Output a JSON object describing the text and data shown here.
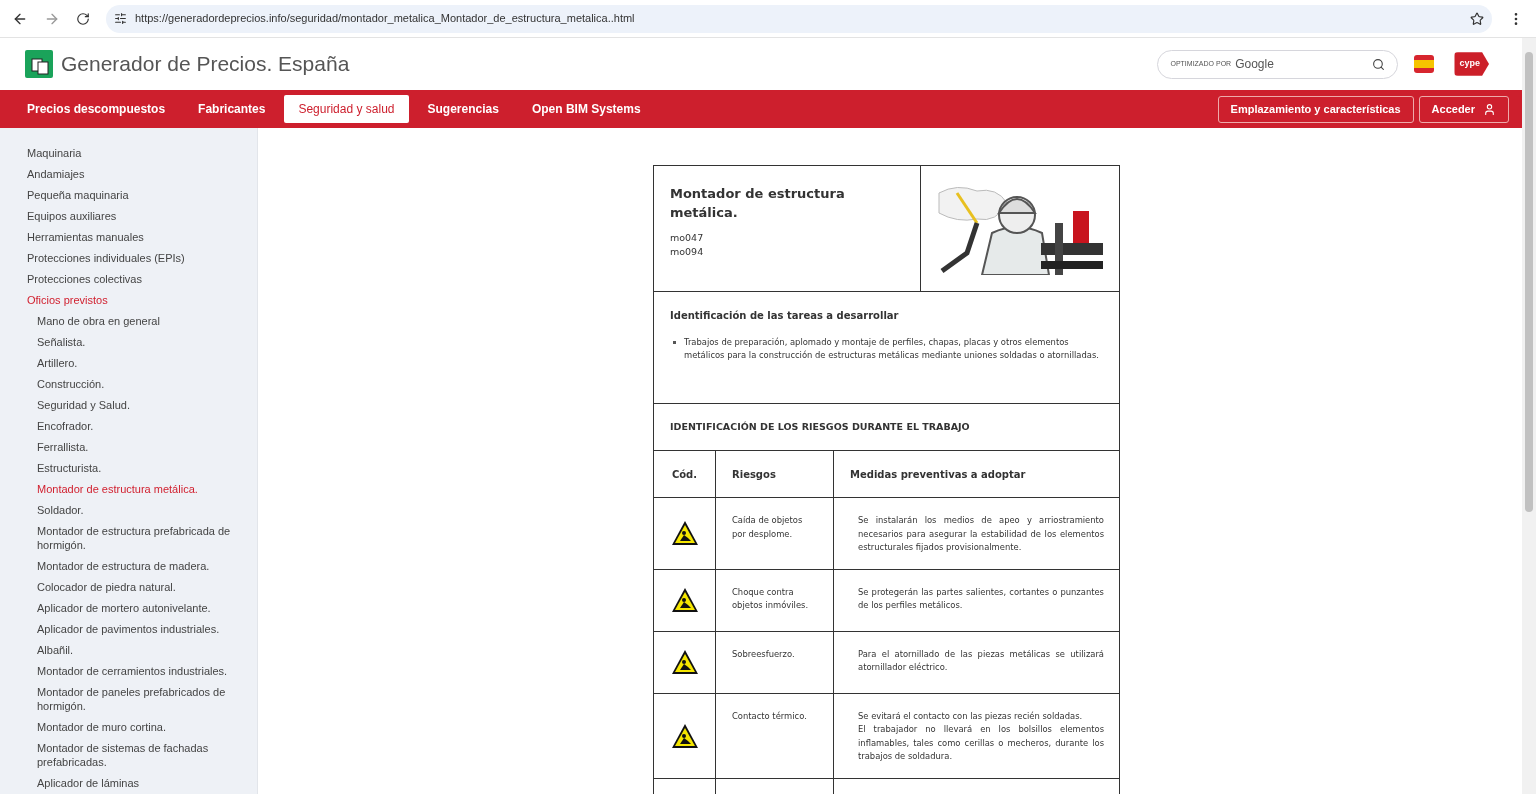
{
  "browser": {
    "url": "https://generadordeprecios.info/seguridad/montador_metalica_Montador_de_estructura_metalica..html"
  },
  "header": {
    "title": "Generador de Precios. España",
    "search": {
      "label": "OPTIMIZADO POR",
      "brand": "Google"
    },
    "logo_text": "cype"
  },
  "nav": {
    "tabs": [
      {
        "label": "Precios descompuestos",
        "selected": false
      },
      {
        "label": "Fabricantes",
        "selected": false
      },
      {
        "label": "Seguridad y salud",
        "selected": true
      },
      {
        "label": "Sugerencias",
        "selected": false
      },
      {
        "label": "Open BIM Systems",
        "selected": false
      }
    ],
    "buttons": [
      "Emplazamiento y características",
      "Acceder"
    ]
  },
  "sidebar": {
    "items": [
      {
        "label": "Maquinaria",
        "selected": false
      },
      {
        "label": "Andamiajes",
        "selected": false
      },
      {
        "label": "Pequeña maquinaria",
        "selected": false
      },
      {
        "label": "Equipos auxiliares",
        "selected": false
      },
      {
        "label": "Herramientas manuales",
        "selected": false
      },
      {
        "label": "Protecciones individuales (EPIs)",
        "selected": false
      },
      {
        "label": "Protecciones colectivas",
        "selected": false
      },
      {
        "label": "Oficios previstos",
        "selected": true,
        "children": [
          {
            "label": "Mano de obra en general",
            "selected": false
          },
          {
            "label": "Señalista.",
            "selected": false
          },
          {
            "label": "Artillero.",
            "selected": false
          },
          {
            "label": "Construcción.",
            "selected": false
          },
          {
            "label": "Seguridad y Salud.",
            "selected": false
          },
          {
            "label": "Encofrador.",
            "selected": false
          },
          {
            "label": "Ferrallista.",
            "selected": false
          },
          {
            "label": "Estructurista.",
            "selected": false
          },
          {
            "label": "Montador de estructura metálica.",
            "selected": true
          },
          {
            "label": "Soldador.",
            "selected": false
          },
          {
            "label": "Montador de estructura prefabricada de hormigón.",
            "selected": false
          },
          {
            "label": "Montador de estructura de madera.",
            "selected": false
          },
          {
            "label": "Colocador de piedra natural.",
            "selected": false
          },
          {
            "label": "Aplicador de mortero autonivelante.",
            "selected": false
          },
          {
            "label": "Aplicador de pavimentos industriales.",
            "selected": false
          },
          {
            "label": "Albañil.",
            "selected": false
          },
          {
            "label": "Montador de cerramientos industriales.",
            "selected": false
          },
          {
            "label": "Montador de paneles prefabricados de hormigón.",
            "selected": false
          },
          {
            "label": "Montador de muro cortina.",
            "selected": false
          },
          {
            "label": "Montador de sistemas de fachadas prefabricadas.",
            "selected": false
          },
          {
            "label": "Aplicador de láminas",
            "selected": false
          }
        ]
      }
    ]
  },
  "card": {
    "title": "Montador de estructura metálica.",
    "codes": [
      "mo047",
      "mo094"
    ],
    "tasks": {
      "heading": "Identificación de las tareas a desarrollar",
      "items": [
        "Trabajos de preparación, aplomado y montaje de perfiles, chapas, placas y otros elementos metálicos para la construcción de estructuras metálicas mediante uniones soldadas o atornilladas."
      ]
    },
    "risks": {
      "heading": "IDENTIFICACIÓN DE LOS RIESGOS DURANTE EL TRABAJO",
      "columns": [
        "Cód.",
        "Riesgos",
        "Medidas preventivas a adoptar"
      ],
      "rows": [
        {
          "risk": "Caída de objetos por desplome.",
          "measures": [
            "Se instalarán los medios de apeo y arriostramiento necesarios para asegurar la estabilidad de los elementos estructurales fijados provisionalmente."
          ]
        },
        {
          "risk": "Choque contra objetos inmóviles.",
          "measures": [
            "Se protegerán las partes salientes, cortantes o punzantes de los perfiles metálicos."
          ]
        },
        {
          "risk": "Sobreesfuerzo.",
          "measures": [
            "Para el atornillado de las piezas metálicas se utilizará atornillador eléctrico."
          ]
        },
        {
          "risk": "Contacto térmico.",
          "measures": [
            "Se evitará el contacto con las piezas recién soldadas.",
            "El trabajador no llevará en los bolsillos elementos inflamables, tales como cerillas o mecheros, durante los trabajos de soldadura."
          ]
        }
      ]
    }
  }
}
